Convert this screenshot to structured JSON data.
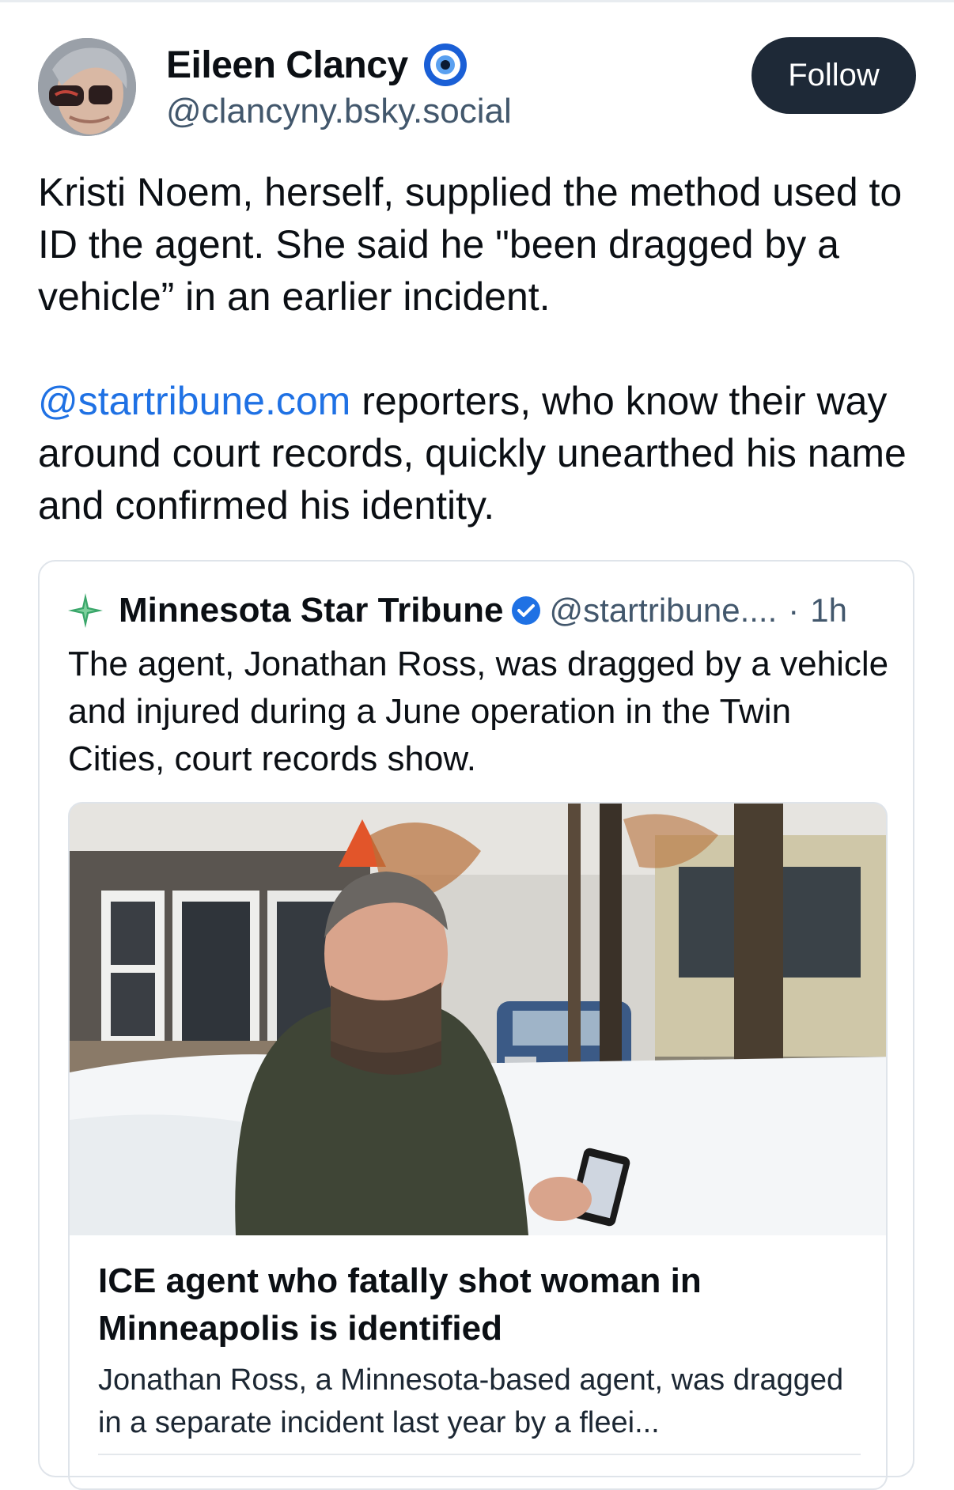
{
  "author": {
    "display_name": "Eileen Clancy",
    "handle": "@clancyny.bsky.social",
    "avatar_icon": "profile-photo",
    "verified_icon": "eye-badge-icon"
  },
  "follow_label": "Follow",
  "post": {
    "paragraph1": "Kristi Noem, herself, supplied the method used to ID the agent. She said he \"been dragged by a vehicle” in an earlier incident.",
    "mention": "@startribune.com",
    "paragraph2_rest": " reporters, who know their way around court records, quickly unearthed his name and confirmed his identity."
  },
  "quote": {
    "name": "Minnesota Star Tribune",
    "handle": "@startribune....",
    "separator": "·",
    "time": "1h",
    "text": "The agent, Jonathan Ross, was dragged by a vehicle and injured during a June operation in the Twin Cities, court records show.",
    "logo_icon": "star-tribune-logo-icon",
    "verified_icon": "verified-check-icon"
  },
  "embed": {
    "title": "ICE agent who fatally shot woman in Minneapolis is identified",
    "description": "Jonathan Ross, a Minnesota-based agent, was dragged in a separate incident last year by a fleei..."
  },
  "colors": {
    "accent": "#1f71e4",
    "follow_bg": "#1e2937",
    "muted": "#42576c"
  }
}
